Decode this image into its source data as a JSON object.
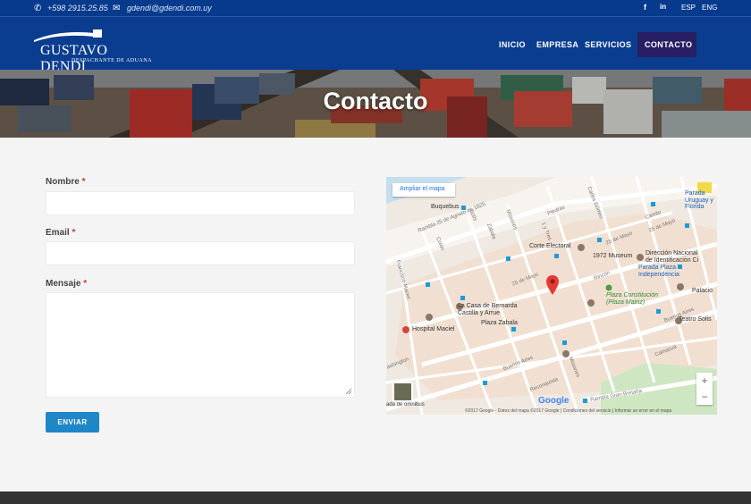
{
  "topbar": {
    "phone": "+598 2915.25.85",
    "email": "gdendi@gdendi.com.uy",
    "languages": [
      "ESP",
      "ENG"
    ]
  },
  "logo": {
    "name": "GUSTAVO DENDI",
    "tagline": "DESPACHANTE DE ADUANA"
  },
  "nav": {
    "items": [
      "INICIO",
      "EMPRESA",
      "SERVICIOS"
    ],
    "active": "CONTACTO"
  },
  "hero": {
    "title": "Contacto"
  },
  "form": {
    "name_label": "Nombre",
    "email_label": "Email",
    "message_label": "Mensaje",
    "required_mark": "*",
    "submit": "ENVIAR"
  },
  "map": {
    "enlarge": "Ampliar el mapa",
    "places": {
      "buquebus": "Buquebus",
      "corte": "Corte Electoral",
      "museum": "1972 Museum",
      "direccion1": "Dirección Nacional",
      "direccion2": "de Identificación Ci",
      "parada1": "Parada Plaza",
      "parada2": "Independencia",
      "plaza1": "Plaza Constitución",
      "plaza2": "(Plaza Matriz)",
      "casa1": "La Casa de Bernarda",
      "casa2": "Castilla y Arrue",
      "plaza_zabala": "Plaza Zabala",
      "hospital": "Hospital Maciel",
      "teatro": "Teatro Solis",
      "palacio": "Palacio",
      "parada_ur1": "Parada",
      "parada_ur2": "Uruguay y Florida",
      "omnibus": "ada de ómnibus"
    },
    "streets": {
      "rambla": "Rambla 25 de Agosto de 1825",
      "piedras": "Piedras",
      "cerrito": "Cerrito",
      "mayo1": "25 de Mayo",
      "mayo2": "25 de Mayo",
      "mayo3": "25 de Mayo",
      "rincon": "Rincón",
      "solis": "Solís",
      "zabala": "Zabala",
      "misiones": "Misiones",
      "colon": "Colón",
      "buenos_aires1": "Buenos Aires",
      "buenos_aires2": "Buenos Aires",
      "reconquista": "Reconquista",
      "washington": "ashington",
      "maciel": "Francisco Maciel",
      "itres": "1 y Tres",
      "carlos": "Carlos Gómez",
      "camacua": "Camacuá",
      "rambla_gb": "Rambla Gran Bretaña",
      "misiones2": "Misiones"
    },
    "footer": "©2017 Google - Datos del mapa ©2017 Google  |  Condiciones del servicio  |  Informar un error en el mapa",
    "google": "Google",
    "zoom_in": "+",
    "zoom_out": "−"
  }
}
